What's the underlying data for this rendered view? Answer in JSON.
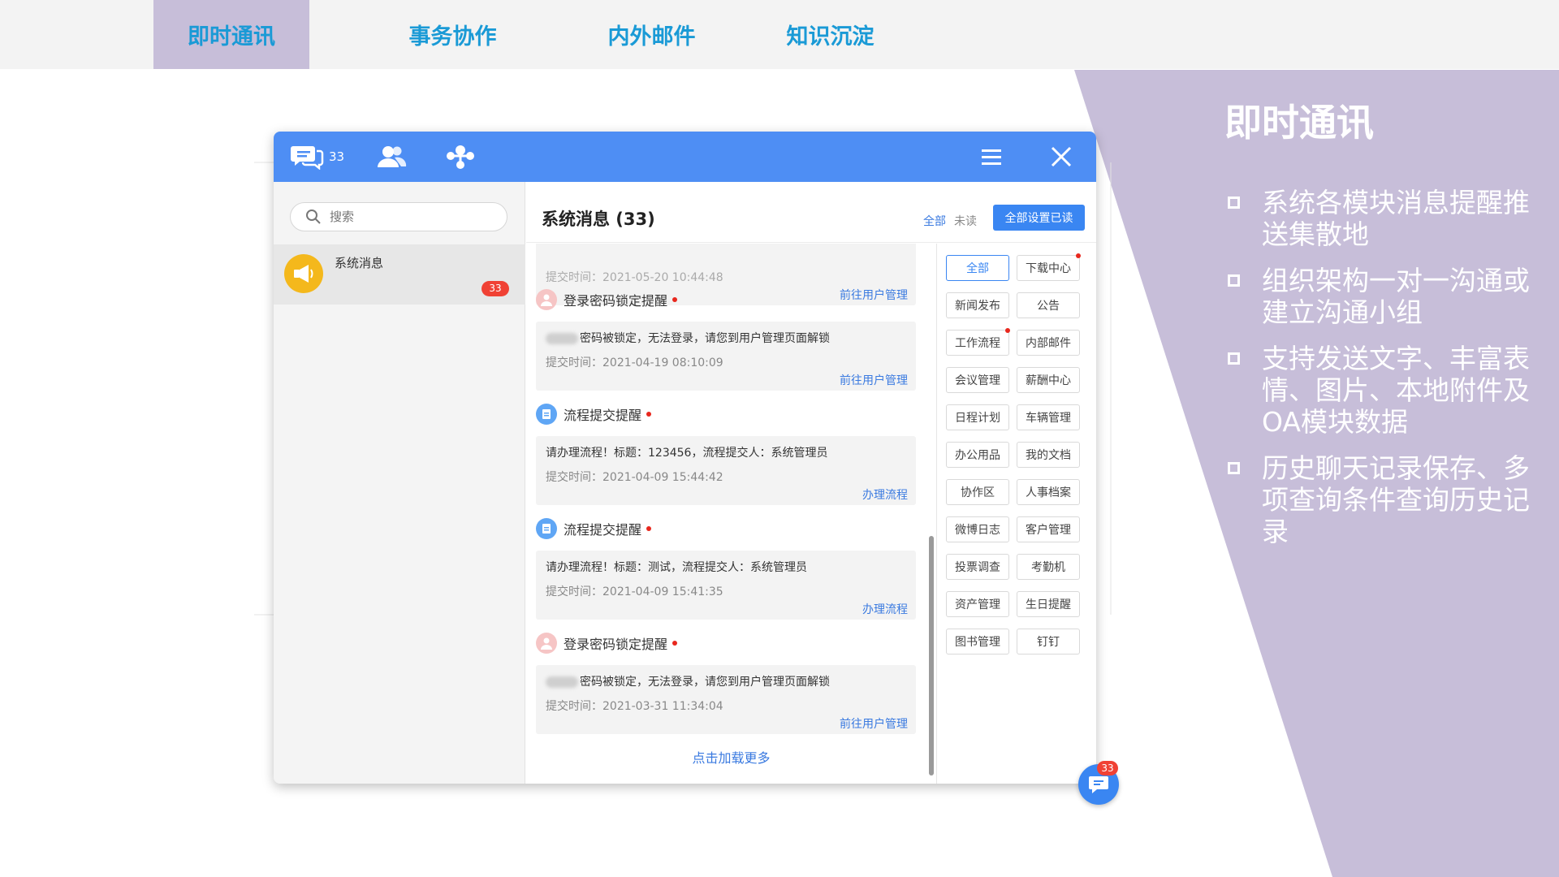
{
  "nav": {
    "tabs": [
      {
        "label": "即时通讯",
        "active": true
      },
      {
        "label": "事务协作",
        "active": false
      },
      {
        "label": "内外邮件",
        "active": false
      },
      {
        "label": "知识沉淀",
        "active": false
      }
    ]
  },
  "panel": {
    "title": "即时通讯",
    "bullets": [
      "系统各模块消息提醒推送集散地",
      "组织架构一对一沟通或建立沟通小组",
      "支持发送文字、丰富表情、图片、本地附件及OA模块数据",
      "历史聊天记录保存、多项查询条件查询历史记录"
    ]
  },
  "app": {
    "titlebar": {
      "messages_count": "33",
      "icons": [
        "chat-bubbles-icon",
        "contacts-icon",
        "org-tree-icon",
        "menu-icon",
        "close-icon"
      ]
    },
    "search": {
      "placeholder": "搜索"
    },
    "conversation": {
      "name": "系统消息",
      "badge": "33",
      "icon": "megaphone-icon"
    },
    "header": {
      "title": "系统消息 (33)",
      "filter_all": "全部",
      "filter_unread": "未读",
      "mark_all_read": "全部设置已读"
    },
    "messages": [
      {
        "title": "",
        "text": "",
        "time": "提交时间：2021-05-20 10:44:48",
        "link": "前往用户管理",
        "icon": "user-icon"
      },
      {
        "title": "登录密码锁定提醒",
        "text": "密码被锁定，无法登录，请您到用户管理页面解锁",
        "time": "提交时间：2021-04-19 08:10:09",
        "link": "前往用户管理",
        "icon": "user-icon",
        "redacted": true
      },
      {
        "title": "流程提交提醒",
        "text": "请办理流程！标题：123456，流程提交人：系统管理员",
        "time": "提交时间：2021-04-09 15:44:42",
        "link": "办理流程",
        "icon": "workflow-icon"
      },
      {
        "title": "流程提交提醒",
        "text": "请办理流程！标题：测试，流程提交人：系统管理员",
        "time": "提交时间：2021-04-09 15:41:35",
        "link": "办理流程",
        "icon": "workflow-icon"
      },
      {
        "title": "登录密码锁定提醒",
        "text": "密码被锁定，无法登录，请您到用户管理页面解锁",
        "time": "提交时间：2021-03-31 11:34:04",
        "link": "前往用户管理",
        "icon": "user-icon",
        "redacted": true
      }
    ],
    "load_more": "点击加载更多",
    "categories": [
      {
        "label": "全部",
        "selected": true,
        "dot": false
      },
      {
        "label": "下载中心",
        "selected": false,
        "dot": true
      },
      {
        "label": "新闻发布",
        "selected": false,
        "dot": false
      },
      {
        "label": "公告",
        "selected": false,
        "dot": false
      },
      {
        "label": "工作流程",
        "selected": false,
        "dot": true
      },
      {
        "label": "内部邮件",
        "selected": false,
        "dot": false
      },
      {
        "label": "会议管理",
        "selected": false,
        "dot": false
      },
      {
        "label": "薪酬中心",
        "selected": false,
        "dot": false
      },
      {
        "label": "日程计划",
        "selected": false,
        "dot": false
      },
      {
        "label": "车辆管理",
        "selected": false,
        "dot": false
      },
      {
        "label": "办公用品",
        "selected": false,
        "dot": false
      },
      {
        "label": "我的文档",
        "selected": false,
        "dot": false
      },
      {
        "label": "协作区",
        "selected": false,
        "dot": false
      },
      {
        "label": "人事档案",
        "selected": false,
        "dot": false
      },
      {
        "label": "微博日志",
        "selected": false,
        "dot": false
      },
      {
        "label": "客户管理",
        "selected": false,
        "dot": false
      },
      {
        "label": "投票调查",
        "selected": false,
        "dot": false
      },
      {
        "label": "考勤机",
        "selected": false,
        "dot": false
      },
      {
        "label": "资产管理",
        "selected": false,
        "dot": false
      },
      {
        "label": "生日提醒",
        "selected": false,
        "dot": false
      },
      {
        "label": "图书管理",
        "selected": false,
        "dot": false
      },
      {
        "label": "钉钉",
        "selected": false,
        "dot": false
      }
    ],
    "fab_badge": "33"
  },
  "colors": {
    "nav_bg": "#f3f3f3",
    "nav_active": "#c7bed9",
    "nav_text": "#1a9ad6",
    "panel_purple": "#c7bed9",
    "titlebar_blue": "#4e8ef4",
    "badge_red": "#f04134"
  }
}
